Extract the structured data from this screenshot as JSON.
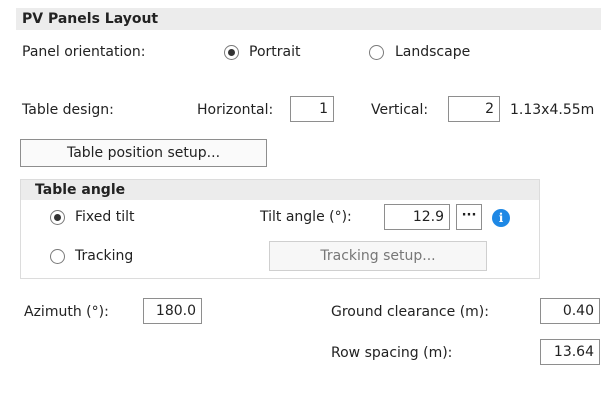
{
  "section": {
    "title": "PV Panels Layout"
  },
  "orientation": {
    "label": "Panel orientation:",
    "options": [
      {
        "label": "Portrait",
        "selected": true
      },
      {
        "label": "Landscape",
        "selected": false
      }
    ]
  },
  "table_design": {
    "label": "Table design:",
    "horizontal_label": "Horizontal:",
    "horizontal_value": "1",
    "vertical_label": "Vertical:",
    "vertical_value": "2",
    "dimensions": "1.13x4.55m"
  },
  "table_position_button": "Table position setup...",
  "table_angle": {
    "title": "Table angle",
    "fixed_tilt": {
      "label": "Fixed tilt",
      "selected": true
    },
    "tracking": {
      "label": "Tracking",
      "selected": false
    },
    "tilt_label": "Tilt angle (°):",
    "tilt_value": "12.9",
    "more_button": "···",
    "info_icon": "i",
    "tracking_button": "Tracking setup..."
  },
  "azimuth": {
    "label": "Azimuth (°):",
    "value": "180.0"
  },
  "ground_clearance": {
    "label": "Ground clearance (m):",
    "value": "0.40"
  },
  "row_spacing": {
    "label": "Row spacing (m):",
    "value": "13.64"
  },
  "colors": {
    "header_bg": "#ececec",
    "info_blue": "#1e88e5"
  }
}
